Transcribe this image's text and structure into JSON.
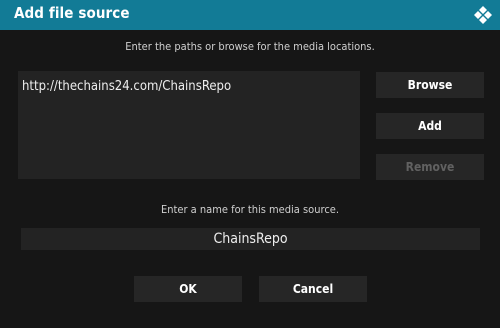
{
  "dialog": {
    "title": "Add file source",
    "logo_icon": "kodi-logo-icon"
  },
  "paths": {
    "hint": "Enter the paths or browse for the media locations.",
    "items": [
      "http://thechains24.com/ChainsRepo"
    ]
  },
  "buttons": {
    "browse": "Browse",
    "add": "Add",
    "remove": "Remove",
    "ok": "OK",
    "cancel": "Cancel"
  },
  "name": {
    "hint": "Enter a name for this media source.",
    "value": "ChainsRepo"
  },
  "colors": {
    "title_bar": "#127b96",
    "background": "#161616",
    "button": "#262626",
    "disabled_text": "#616161"
  }
}
